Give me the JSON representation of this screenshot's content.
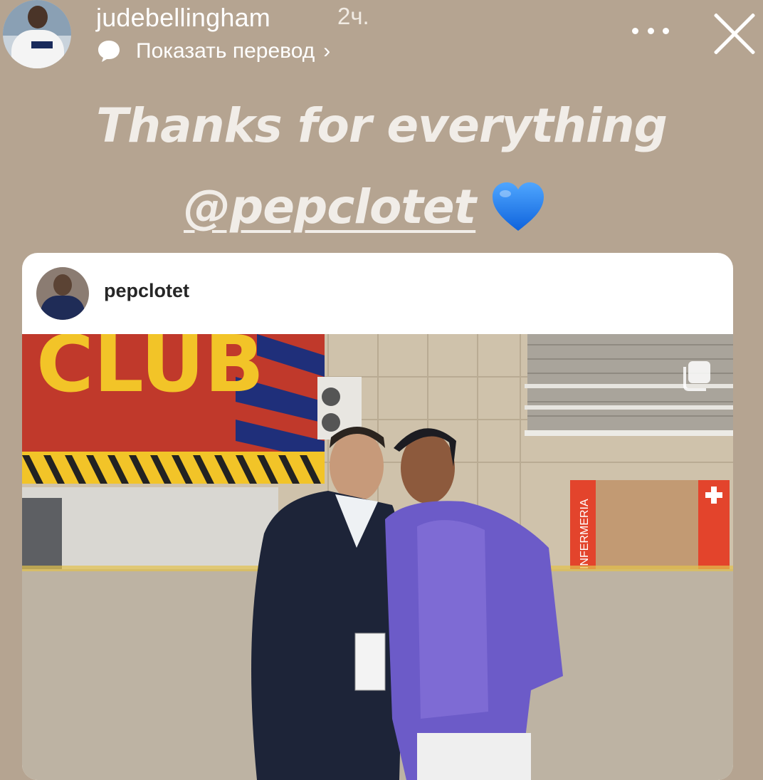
{
  "story": {
    "username": "judebellingham",
    "time_ago": "2ч.",
    "translate_label": "Показать перевод",
    "translate_chevron": "›",
    "more_icon": "more-horizontal-icon",
    "close_icon": "close-icon"
  },
  "caption": {
    "line1": "Thanks for everything",
    "mention": "@pepclotet",
    "heart_color": "#1a7cf5"
  },
  "shared_post": {
    "username": "pepclotet",
    "photo_banner_text": "CLUB",
    "wall_sign": "INFERMERIA",
    "multi_photo_icon": "carousel-icon"
  },
  "colors": {
    "background": "#b5a491",
    "card": "#ffffff"
  }
}
